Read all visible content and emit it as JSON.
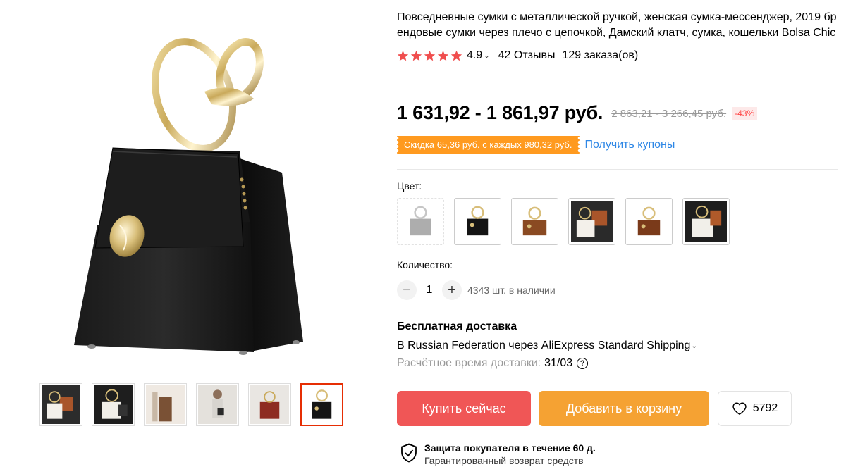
{
  "product": {
    "title": "Повседневные сумки с металлической ручкой, женская сумка-мессенджер, 2019 брендовые сумки через плечо с цепочкой, Дамский клатч, сумка, кошельки Bolsa Chic",
    "rating": "4.9",
    "rating_stars": 5,
    "reviews": "42 Отзывы",
    "orders": "129 заказа(ов)"
  },
  "price": {
    "current": "1 631,92 - 1 861,97 руб.",
    "old": "2 863,21 - 3 266,45 руб.",
    "discount": "-43%"
  },
  "coupon": {
    "text": "Скидка 65,36 руб. с каждых 980,32 руб.",
    "link": "Получить купоны"
  },
  "options": {
    "color_label": "Цвет:",
    "swatches": [
      "grey",
      "black",
      "brown",
      "white-brown",
      "brown",
      "white-black"
    ],
    "quantity_label": "Количество:",
    "quantity": "1",
    "stock": "4343 шт. в наличии"
  },
  "shipping": {
    "title": "Бесплатная доставка",
    "method": "В Russian Federation через AliExpress Standard Shipping",
    "eta_label": "Расчётное время доставки:",
    "eta_value": "31/03"
  },
  "actions": {
    "buy": "Купить сейчас",
    "cart": "Добавить в корзину",
    "wishlist_count": "5792"
  },
  "protection": {
    "title": "Защита покупателя в течение 60 д.",
    "subtitle": "Гарантированный возврат средств"
  },
  "gallery": {
    "thumbnails": [
      "white-brown",
      "white-black",
      "brown-side",
      "model",
      "red-bag",
      "black-bag"
    ],
    "active_index": 5
  },
  "colors": {
    "accent_red": "#f05656",
    "accent_orange": "#f5a233",
    "star": "#f04e4e",
    "link_blue": "#2e87e6"
  }
}
